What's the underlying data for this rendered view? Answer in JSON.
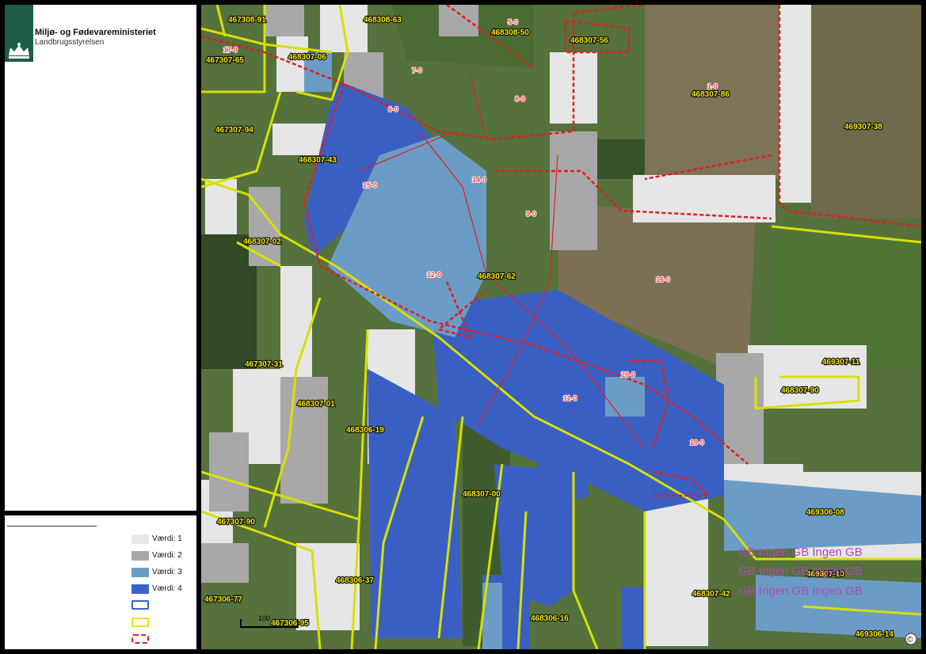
{
  "header": {
    "ministry": "Miljø- og Fødevareministeriet",
    "agency": "Landbrugsstyrelsen"
  },
  "legend": {
    "items": [
      {
        "label": "Værdi: 1",
        "color": "#e8e8e8",
        "kind": "fill"
      },
      {
        "label": "Værdi: 2",
        "color": "#a9a9a9",
        "kind": "fill"
      },
      {
        "label": "Værdi: 3",
        "color": "#6d9cc2",
        "kind": "fill"
      },
      {
        "label": "Værdi: 4",
        "color": "#3a62c4",
        "kind": "fill"
      },
      {
        "label": "",
        "color": "#3a62c4",
        "kind": "outline"
      },
      {
        "label": "",
        "color": "#e6e600",
        "kind": "outline"
      },
      {
        "label": "",
        "color": "#e02020",
        "kind": "dashed"
      }
    ]
  },
  "map": {
    "field_labels": [
      "467308-91",
      "468308-63",
      "468308-50",
      "468307-56",
      "467307-65",
      "468307-06",
      "468307-86",
      "467307-94",
      "469307-38",
      "468307-43",
      "468307-02",
      "468307-62",
      "467307-31",
      "468307-01",
      "468306-19",
      "469307-11",
      "468307-90",
      "468307-00",
      "469306-08",
      "467307-90",
      "468306-37",
      "467306-77",
      "467306-95",
      "468306-16",
      "468307-42",
      "469307-10",
      "469306-14"
    ],
    "lot_labels": [
      "5-0",
      "7-0",
      "8-0",
      "17-0",
      "1-0",
      "6-0",
      "15-0",
      "14-0",
      "9-0",
      "12-0",
      "16-0",
      "11-0",
      "20-0",
      "19-0"
    ],
    "gb_rows": [
      "GB  Ingen GB  Ingen GB",
      "GB  Ingen GB  Ingen GB",
      "GB  Ingen GB  Ingen GB"
    ],
    "scale_label": "100",
    "copyright": "©"
  }
}
